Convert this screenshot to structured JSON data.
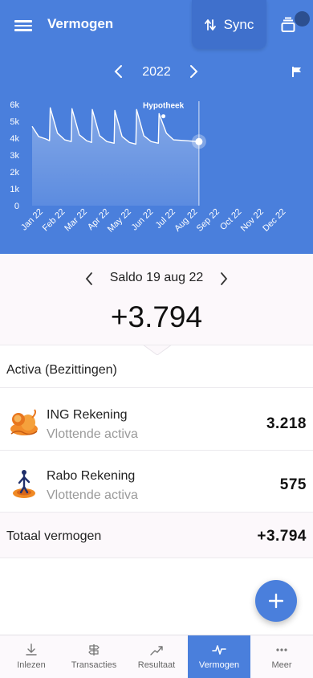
{
  "header": {
    "title": "Vermogen",
    "sync_label": "Sync",
    "year": "2022",
    "colors": {
      "header_bg": "#4a7fdc",
      "sync_bg": "#3f70cc",
      "accent": "#4a7fdc"
    }
  },
  "chart_data": {
    "type": "area",
    "categories": [
      "Jan 22",
      "Feb 22",
      "Mar 22",
      "Apr 22",
      "May 22",
      "Jun 22",
      "Jul 22",
      "Aug 22",
      "Sep 22",
      "Oct 22",
      "Nov 22",
      "Dec 22"
    ],
    "y_ticks": [
      "0",
      "1k",
      "2k",
      "3k",
      "4k",
      "5k",
      "6k"
    ],
    "ylim": [
      0,
      6000
    ],
    "series": [
      {
        "points": [
          [
            "2022-01-01",
            4700
          ],
          [
            "2022-01-10",
            4100
          ],
          [
            "2022-01-20",
            3950
          ],
          [
            "2022-01-25",
            3850
          ],
          [
            "2022-01-26",
            5800
          ],
          [
            "2022-02-05",
            4300
          ],
          [
            "2022-02-15",
            3900
          ],
          [
            "2022-02-24",
            3800
          ],
          [
            "2022-02-25",
            5750
          ],
          [
            "2022-03-07",
            4200
          ],
          [
            "2022-03-17",
            3850
          ],
          [
            "2022-03-24",
            3750
          ],
          [
            "2022-03-25",
            5700
          ],
          [
            "2022-04-04",
            4150
          ],
          [
            "2022-04-14",
            3800
          ],
          [
            "2022-04-24",
            3700
          ],
          [
            "2022-04-25",
            5650
          ],
          [
            "2022-05-05",
            4100
          ],
          [
            "2022-05-15",
            3750
          ],
          [
            "2022-05-24",
            3650
          ],
          [
            "2022-05-25",
            5700
          ],
          [
            "2022-06-04",
            4150
          ],
          [
            "2022-06-14",
            3800
          ],
          [
            "2022-06-24",
            3700
          ],
          [
            "2022-06-25",
            5450
          ],
          [
            "2022-07-05",
            4300
          ],
          [
            "2022-07-15",
            3900
          ],
          [
            "2022-07-31",
            3850
          ],
          [
            "2022-08-19",
            3794
          ]
        ]
      }
    ],
    "annotations": [
      {
        "label": "Hypotheek",
        "x": "2022-07-01",
        "y": 5300
      }
    ],
    "selected": {
      "x": "2022-08-19",
      "y": 3794
    },
    "grid": false
  },
  "saldo": {
    "label": "Saldo 19 aug 22",
    "value": "+3.794"
  },
  "section": {
    "title": "Activa (Bezittingen)"
  },
  "accounts": [
    {
      "name": "ING Rekening",
      "type": "Vlottende activa",
      "amount": "3.218",
      "logo": "ing-lion-icon"
    },
    {
      "name": "Rabo Rekening",
      "type": "Vlottende activa",
      "amount": "575",
      "logo": "rabo-figure-icon"
    }
  ],
  "total": {
    "label": "Totaal vermogen",
    "value": "+3.794"
  },
  "nav": [
    {
      "label": "Inlezen",
      "icon": "download-icon",
      "active": false
    },
    {
      "label": "Transacties",
      "icon": "signpost-icon",
      "active": false
    },
    {
      "label": "Resultaat",
      "icon": "trend-icon",
      "active": false
    },
    {
      "label": "Vermogen",
      "icon": "pulse-icon",
      "active": true
    },
    {
      "label": "Meer",
      "icon": "more-icon",
      "active": false
    }
  ]
}
